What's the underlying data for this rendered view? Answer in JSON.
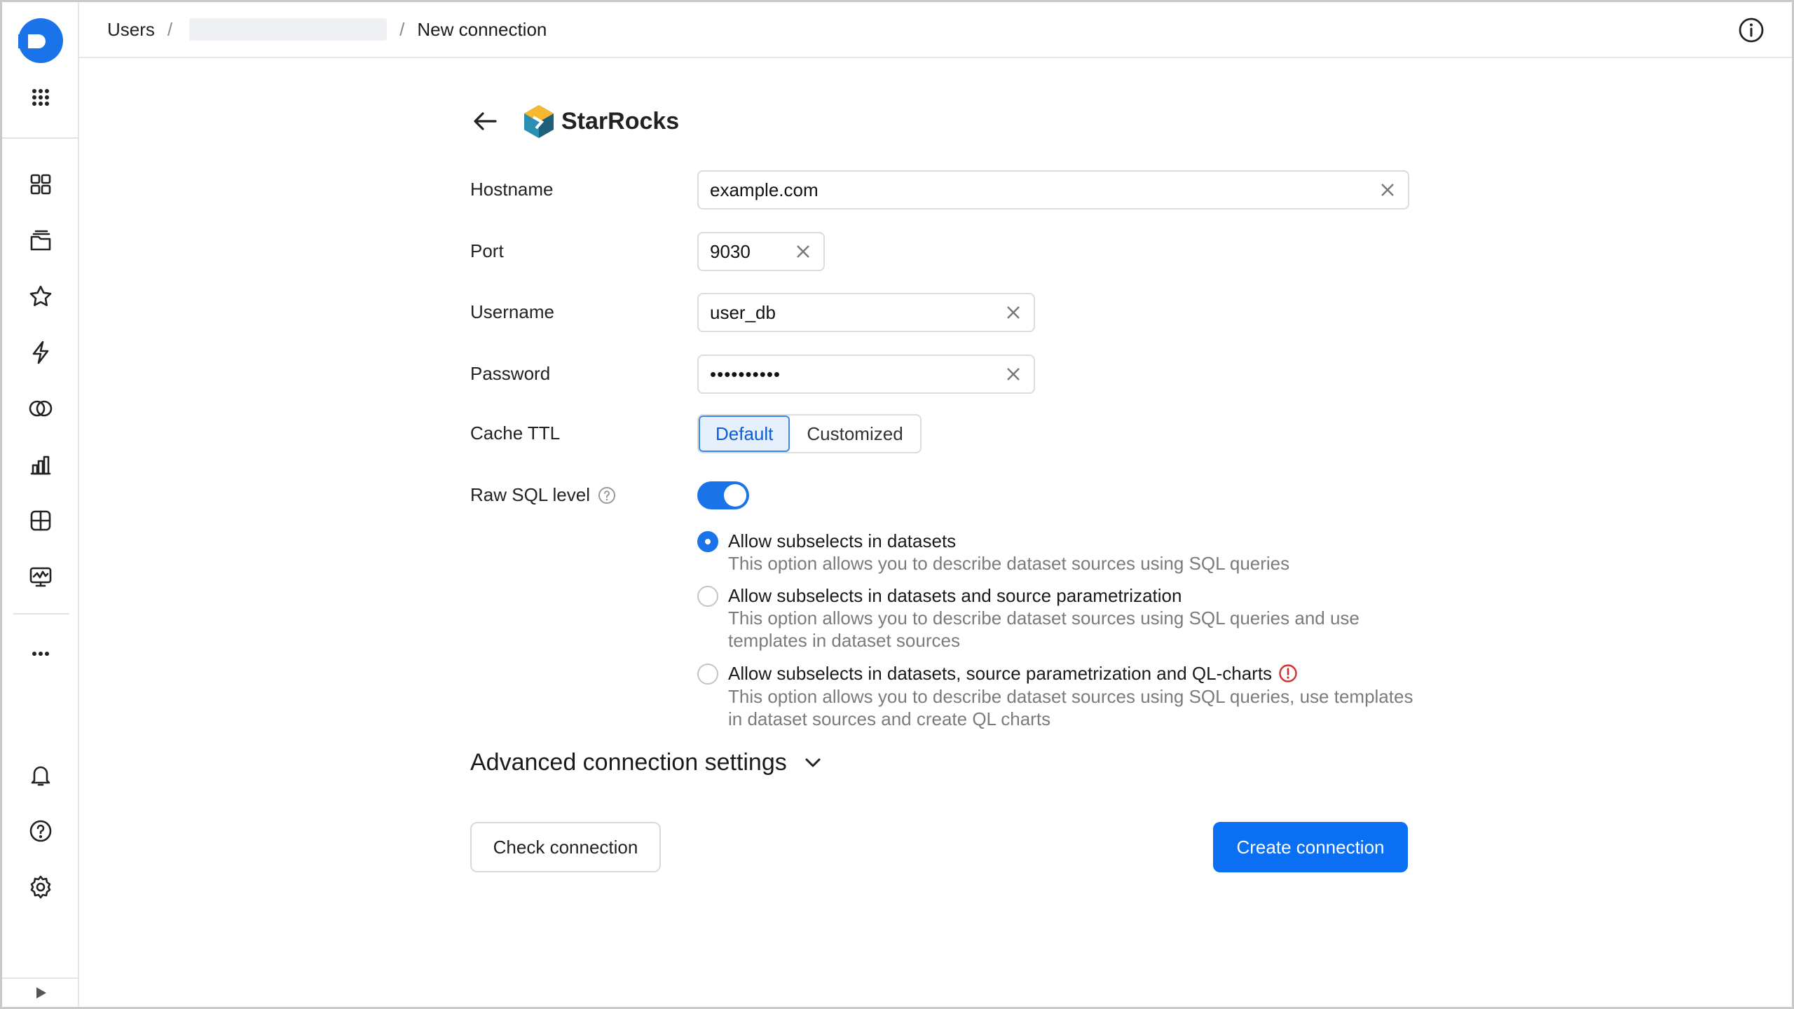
{
  "breadcrumb": {
    "root": "Users",
    "separator": "/",
    "current": "New connection"
  },
  "connector": {
    "name": "StarRocks"
  },
  "form": {
    "hostname": {
      "label": "Hostname",
      "value": "example.com"
    },
    "port": {
      "label": "Port",
      "value": "9030"
    },
    "username": {
      "label": "Username",
      "value": "user_db"
    },
    "password": {
      "label": "Password",
      "value": "••••••••••"
    },
    "cache_ttl": {
      "label": "Cache TTL",
      "options": [
        "Default",
        "Customized"
      ],
      "selected": "Default"
    },
    "raw_sql": {
      "label": "Raw SQL level",
      "enabled": true,
      "options": [
        {
          "title": "Allow subselects in datasets",
          "desc": "This option allows you to describe dataset sources using SQL queries",
          "checked": true
        },
        {
          "title": "Allow subselects in datasets and source parametrization",
          "desc": "This option allows you to describe dataset sources using SQL queries and use templates in dataset sources",
          "checked": false
        },
        {
          "title": "Allow subselects in datasets, source parametrization and QL-charts",
          "desc": "This option allows you to describe dataset sources using SQL queries, use templates in dataset sources and create QL charts",
          "checked": false
        }
      ]
    },
    "advanced_label": "Advanced connection settings"
  },
  "actions": {
    "check": "Check connection",
    "create": "Create connection"
  },
  "colors": {
    "primary": "#0a6ff2",
    "toggle": "#1a73e8",
    "warning": "#d32f2f"
  },
  "icons": {
    "sidebar": [
      "grid-icon",
      "collections-icon",
      "star-icon",
      "bolt-icon",
      "connections-icon",
      "chart-icon",
      "table-icon",
      "dashboard-icon",
      "more-icon",
      "bell-icon",
      "help-icon",
      "settings-icon"
    ]
  }
}
